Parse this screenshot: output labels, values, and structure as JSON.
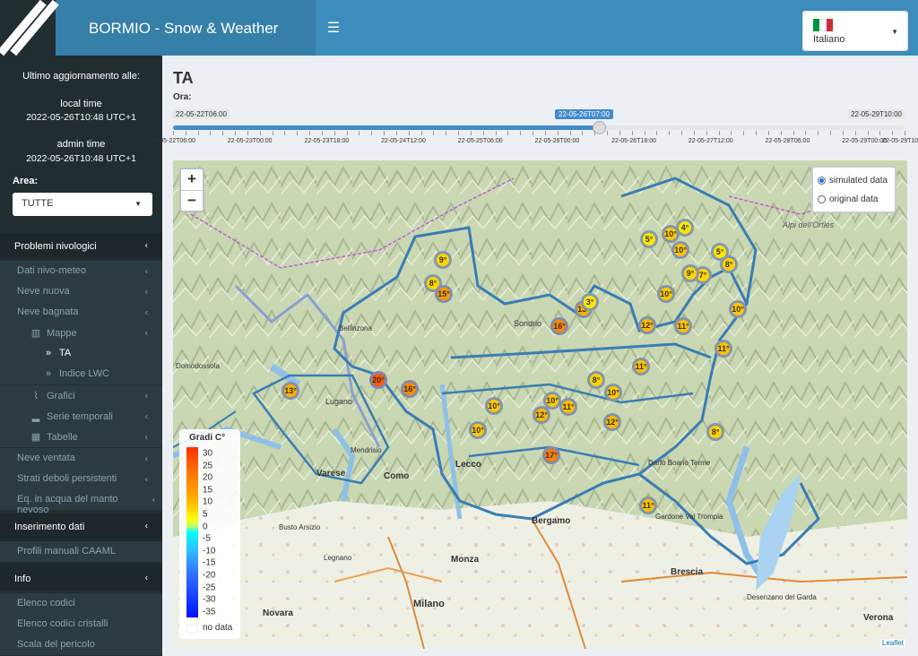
{
  "header": {
    "title": "BORMIO - Snow & Weather",
    "menu_icon": "hamburger-icon",
    "language": "Italiano",
    "flag_colors": [
      "#009246",
      "#ffffff",
      "#ce2b37"
    ]
  },
  "sidebar": {
    "update_heading": "Ultimo aggiornamento alle:",
    "local_label": "local time",
    "local_value": "2022-05-26T10:48 UTC+1",
    "admin_label": "admin time",
    "admin_value": "2022-05-26T10:48 UTC+1",
    "area_label": "Area:",
    "area_value": "TUTTE",
    "items": [
      {
        "label": "Problemi nivologici",
        "type": "header"
      },
      {
        "label": "Dati nivo-meteo",
        "type": "sub"
      },
      {
        "label": "Neve nuova",
        "type": "sub"
      },
      {
        "label": "Neve bagnata",
        "type": "sub"
      },
      {
        "label": "Mappe",
        "type": "sub2",
        "icon": "map-icon"
      },
      {
        "label": "TA",
        "type": "sub3",
        "icon": "double-chevron-icon",
        "active": true
      },
      {
        "label": "Indice LWC",
        "type": "sub3",
        "icon": "double-chevron-icon"
      },
      {
        "label": "Grafici",
        "type": "sub2",
        "icon": "line-chart-icon"
      },
      {
        "label": "Serie temporali",
        "type": "sub2",
        "icon": "bar-chart-icon"
      },
      {
        "label": "Tabelle",
        "type": "sub2",
        "icon": "table-icon"
      },
      {
        "label": "Neve ventata",
        "type": "sub"
      },
      {
        "label": "Strati deboli persistenti",
        "type": "sub"
      },
      {
        "label": "Eq. in acqua del manto nevoso",
        "type": "sub"
      },
      {
        "label": "Inserimento dati",
        "type": "header"
      },
      {
        "label": "Profili manuali CAAML",
        "type": "sub"
      },
      {
        "label": "Info",
        "type": "header"
      },
      {
        "label": "Elenco codici",
        "type": "sub"
      },
      {
        "label": "Elenco codici cristalli",
        "type": "sub"
      },
      {
        "label": "Scala del pericolo",
        "type": "sub"
      }
    ]
  },
  "main": {
    "title": "TA",
    "ora_label": "Ora:",
    "slider": {
      "min_label": "22-05-22T06:00",
      "max_label": "22-05-29T10:00",
      "current_label": "22-05-26T07:00",
      "fraction": 0.582,
      "tick_labels": [
        "22-05-22T06:00",
        "22-05-23T00:00",
        "22-05-23T18:00",
        "22-05-24T12:00",
        "22-05-25T06:00",
        "22-05-26T00:00",
        "22-05-26T18:00",
        "22-05-27T12:00",
        "22-05-28T06:00",
        "22-05-29T00:00",
        "22-05-29T10:00"
      ]
    },
    "map": {
      "zoom_in": "+",
      "zoom_out": "−",
      "layers": [
        {
          "label": "simulated data",
          "checked": true
        },
        {
          "label": "original data",
          "checked": false
        }
      ],
      "legend_title": "Gradi C°",
      "legend_values": [
        "30",
        "25",
        "20",
        "15",
        "10",
        "5",
        "0",
        "-5",
        "-10",
        "-15",
        "-20",
        "-25",
        "-30",
        "-35"
      ],
      "legend_nodata": "no data",
      "attribution": "Leaflet",
      "places": [
        "Sondrio",
        "Lugano",
        "Como",
        "Lecco",
        "Bergamo",
        "Brescia",
        "Monza",
        "Milano",
        "Varese",
        "Novara",
        "Verona",
        "Bellinzona",
        "Domodossola",
        "Mendrisio",
        "Legnano",
        "Busto Arsizio",
        "Darfo Boario Terme",
        "Desenzano del Garda",
        "Gardone Val Trompia",
        "Alpi dell'Ortles"
      ],
      "markers": [
        {
          "value": "9°",
          "color": "#ffd400"
        },
        {
          "value": "8°",
          "color": "#ffd400"
        },
        {
          "value": "15°",
          "color": "#ff9a00"
        },
        {
          "value": "13°",
          "color": "#ffb000"
        },
        {
          "value": "3°",
          "color": "#ffe600"
        },
        {
          "value": "16°",
          "color": "#ff8a00"
        },
        {
          "value": "5°",
          "color": "#ffe600"
        },
        {
          "value": "10°",
          "color": "#ffc800"
        },
        {
          "value": "4°",
          "color": "#ffe600"
        },
        {
          "value": "10°",
          "color": "#ffc800"
        },
        {
          "value": "7°",
          "color": "#ffd800"
        },
        {
          "value": "5°",
          "color": "#ffe600"
        },
        {
          "value": "8°",
          "color": "#ffd400"
        },
        {
          "value": "9°",
          "color": "#ffd400"
        },
        {
          "value": "10°",
          "color": "#ffc800"
        },
        {
          "value": "12°",
          "color": "#ffba00"
        },
        {
          "value": "11°",
          "color": "#ffc000"
        },
        {
          "value": "10°",
          "color": "#ffc800"
        },
        {
          "value": "11°",
          "color": "#ffc000"
        },
        {
          "value": "11°",
          "color": "#ffc000"
        },
        {
          "value": "20°",
          "color": "#ff5a00"
        },
        {
          "value": "16°",
          "color": "#ff8a00"
        },
        {
          "value": "13°",
          "color": "#ffb000"
        },
        {
          "value": "8°",
          "color": "#ffd400"
        },
        {
          "value": "10°",
          "color": "#ffc800"
        },
        {
          "value": "10°",
          "color": "#ffc800"
        },
        {
          "value": "10°",
          "color": "#ffc800"
        },
        {
          "value": "12°",
          "color": "#ffba00"
        },
        {
          "value": "11°",
          "color": "#ffc000"
        },
        {
          "value": "12°",
          "color": "#ffba00"
        },
        {
          "value": "10°",
          "color": "#ffc800"
        },
        {
          "value": "8°",
          "color": "#ffd400"
        },
        {
          "value": "17°",
          "color": "#ff8000"
        },
        {
          "value": "11°",
          "color": "#ffc000"
        }
      ]
    }
  },
  "colors": {
    "header": "#3c8dbc",
    "header_dark": "#367fa9",
    "sidebar": "#222d32",
    "accent": "#428bca"
  }
}
